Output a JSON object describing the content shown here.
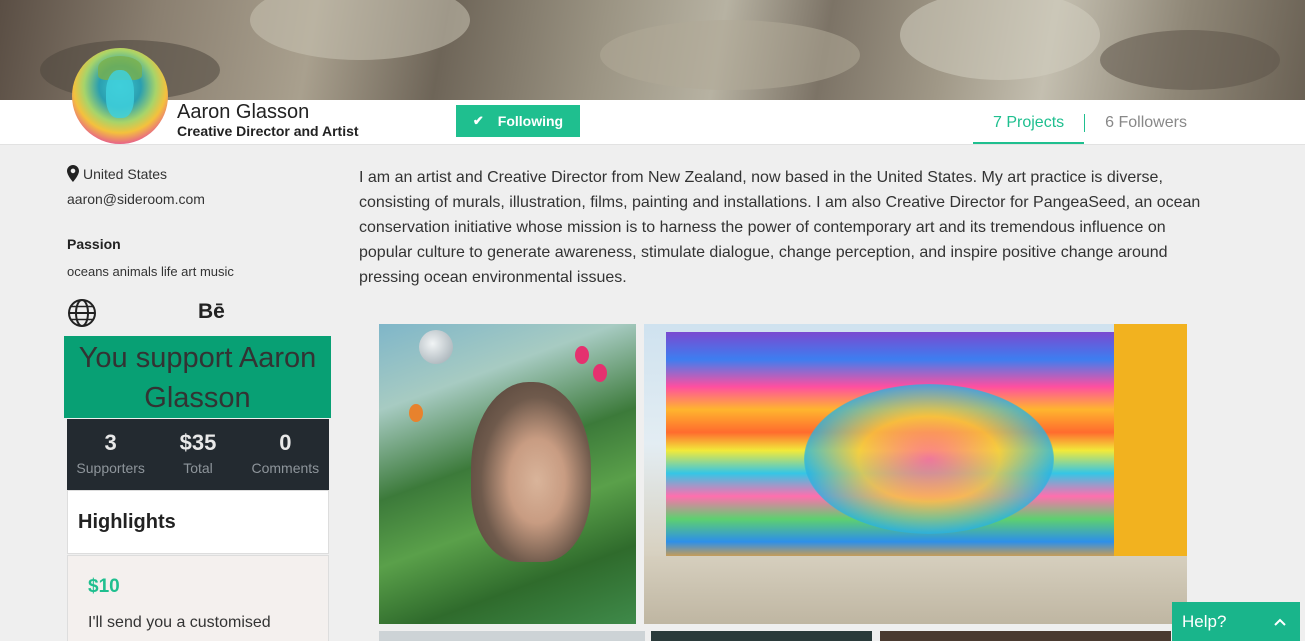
{
  "profile": {
    "name": "Aaron Glasson",
    "role": "Creative Director and Artist",
    "follow_label": "Following",
    "location": "United States",
    "email": "aaron@sideroom.com",
    "passion_heading": "Passion",
    "passion_text": "oceans animals life art music",
    "behance_label": "Bē"
  },
  "tabs": [
    {
      "label": "7 Projects",
      "active": true
    },
    {
      "label": "6 Followers",
      "active": false
    }
  ],
  "bio": "I am an artist and Creative Director from New Zealand, now based in the United States. My art practice is diverse, consisting of murals, illustration, films, painting and installations. I am also Creative Director for PangeaSeed, an ocean conservation initiative whose mission is to harness the power of contemporary art and its tremendous influence on popular culture to generate awareness, stimulate dialogue, change perception, and inspire positive change around pressing ocean environmental issues.",
  "support": {
    "title": "You support Aaron Glasson",
    "stats": [
      {
        "value": "3",
        "label": "Supporters"
      },
      {
        "value": "$35",
        "label": "Total"
      },
      {
        "value": "0",
        "label": "Comments"
      }
    ],
    "highlights_label": "Highlights",
    "reward": {
      "price": "$10",
      "description": "I'll send you a customised"
    }
  },
  "help": {
    "label": "Help?",
    "icon": "chevron-up-icon"
  },
  "colors": {
    "accent": "#1fbf8f",
    "support_bg": "#08a074",
    "stats_bg": "#232a30"
  }
}
